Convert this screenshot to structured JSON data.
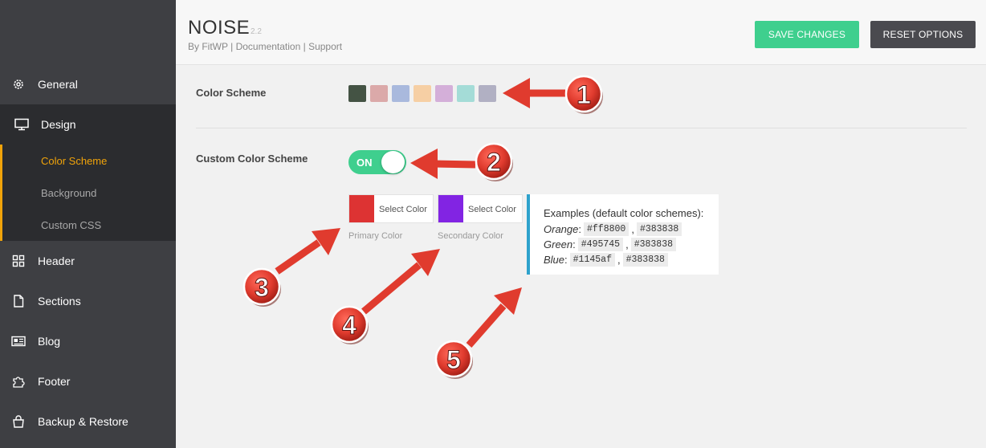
{
  "app": {
    "title": "NOISE",
    "version": "2.2",
    "byline": "By FitWP | Documentation | Support"
  },
  "toolbar": {
    "save_label": "SAVE CHANGES",
    "reset_label": "RESET OPTIONS"
  },
  "sidebar": {
    "items": [
      {
        "label": "General",
        "icon": "gear-icon"
      },
      {
        "label": "Design",
        "icon": "monitor-icon"
      },
      {
        "label": "Header",
        "icon": "grid-icon"
      },
      {
        "label": "Sections",
        "icon": "document-icon"
      },
      {
        "label": "Blog",
        "icon": "newspaper-icon"
      },
      {
        "label": "Footer",
        "icon": "puzzle-icon"
      },
      {
        "label": "Backup & Restore",
        "icon": "bag-icon"
      }
    ],
    "design_subitems": [
      {
        "label": "Color Scheme"
      },
      {
        "label": "Background"
      },
      {
        "label": "Custom CSS"
      }
    ]
  },
  "color_scheme": {
    "label": "Color Scheme",
    "swatches": [
      "#445344",
      "#dba9a9",
      "#a9b9dd",
      "#f6cfa4",
      "#d4afd9",
      "#a4dcd7",
      "#b1b0c3"
    ]
  },
  "custom_scheme": {
    "label": "Custom Color Scheme",
    "toggle_text": "ON",
    "primary": {
      "button": "Select Color",
      "caption": "Primary Color",
      "color": "#dd3333"
    },
    "secondary": {
      "button": "Select Color",
      "caption": "Secondary Color",
      "color": "#8224e3"
    }
  },
  "examples": {
    "title": "Examples (default color schemes):",
    "lines": [
      {
        "name": "Orange",
        "c1": "#ff8800",
        "c2": "#383838"
      },
      {
        "name": "Green",
        "c1": "#495745",
        "c2": "#383838"
      },
      {
        "name": "Blue",
        "c1": "#1145af",
        "c2": "#383838"
      }
    ]
  },
  "annotations": [
    "1",
    "2",
    "3",
    "4",
    "5"
  ],
  "colors": {
    "accent_orange": "#f0a30a",
    "save_green": "#3fcf8e",
    "annotation_red": "#e03b2e",
    "info_blue": "#2ea2cc"
  }
}
